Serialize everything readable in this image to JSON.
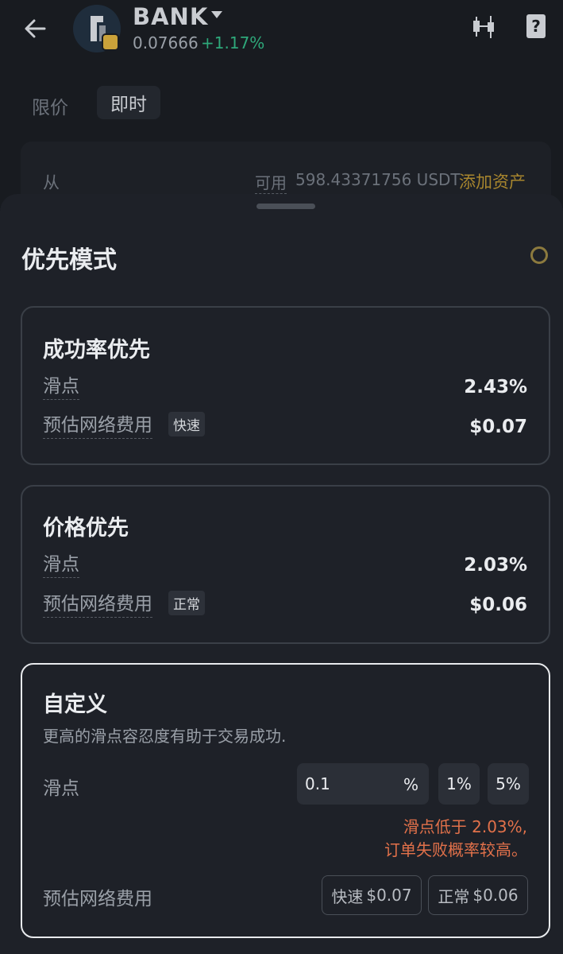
{
  "header": {
    "token_name": "BANK",
    "price": "0.07666",
    "change": "+1.17%"
  },
  "trade_tabs": {
    "limit": "限价",
    "instant": "即时"
  },
  "from_section": {
    "label": "从",
    "available_label": "可用",
    "available_value": "598.43371756 USDT",
    "add_asset": "添加资产"
  },
  "sheet": {
    "title": "优先模式",
    "success_priority": {
      "title": "成功率优先",
      "slippage_label": "滑点",
      "slippage_value": "2.43%",
      "fee_label": "预估网络费用",
      "fee_tag": "快速",
      "fee_value": "$0.07"
    },
    "price_priority": {
      "title": "价格优先",
      "slippage_label": "滑点",
      "slippage_value": "2.03%",
      "fee_label": "预估网络费用",
      "fee_tag": "正常",
      "fee_value": "$0.06"
    },
    "custom": {
      "title": "自定义",
      "description": "更高的滑点容忍度有助于交易成功.",
      "slippage_label": "滑点",
      "slippage_input_value": "0.1",
      "slippage_unit": "%",
      "preset_1": "1%",
      "preset_5": "5%",
      "warning_line1": "滑点低于 2.03%,",
      "warning_line2": "订单失败概率较高。",
      "fee_label": "预估网络费用",
      "fee_fast_label": "快速",
      "fee_fast_value": "$0.07",
      "fee_normal_label": "正常",
      "fee_normal_value": "$0.06"
    }
  },
  "colors": {
    "positive": "#2ea87a",
    "accent": "#a8862e",
    "warning": "#e2714a"
  }
}
